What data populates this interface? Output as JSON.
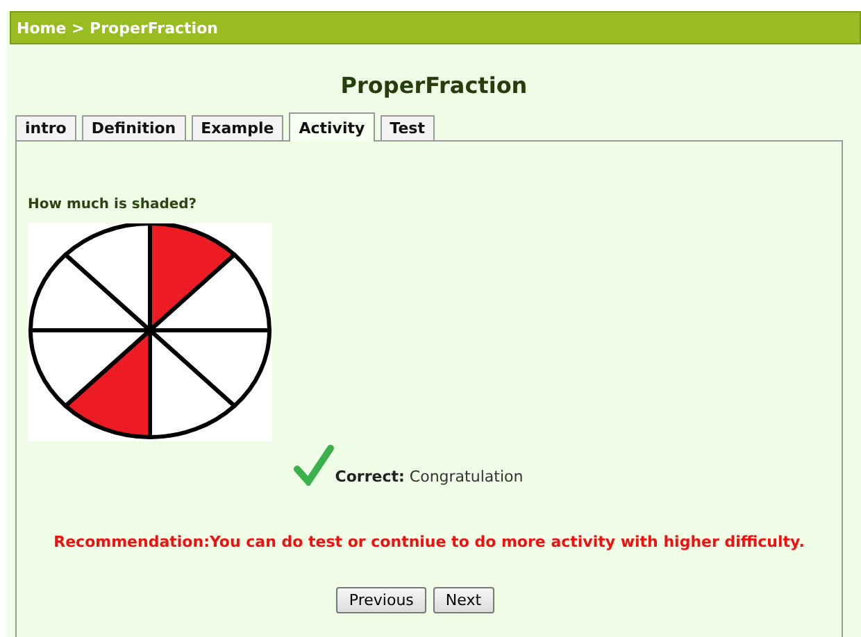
{
  "breadcrumb": "Home > ProperFraction",
  "title": "ProperFraction",
  "tabs": [
    {
      "label": "intro",
      "selected": false
    },
    {
      "label": "Definition",
      "selected": false
    },
    {
      "label": "Example",
      "selected": false
    },
    {
      "label": "Activity",
      "selected": true
    },
    {
      "label": "Test",
      "selected": false
    }
  ],
  "question": "How much is shaded?",
  "pie": {
    "slices": [
      {
        "shaded": true
      },
      {
        "shaded": false
      },
      {
        "shaded": false
      },
      {
        "shaded": false
      },
      {
        "shaded": true
      },
      {
        "shaded": false
      },
      {
        "shaded": false
      },
      {
        "shaded": false
      }
    ]
  },
  "feedback": {
    "kind": "correct",
    "text": "**Correct:** Congratulation"
  },
  "recommendation": "Recommendation:You can do test or contniue to do more activity with higher difficulty.",
  "buttons": [
    "Previous",
    "Next"
  ]
}
